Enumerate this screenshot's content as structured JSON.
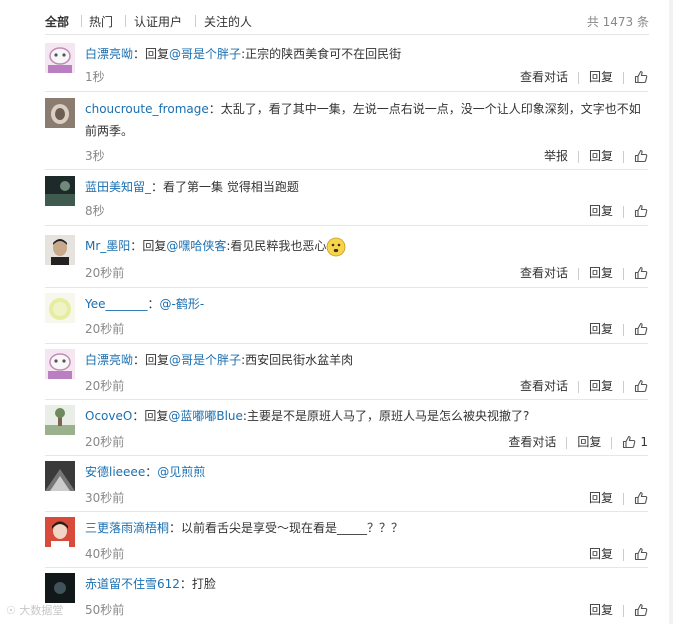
{
  "tabs": {
    "all": "全部",
    "hot": "热门",
    "verified": "认证用户",
    "following": "关注的人",
    "total": "共 1473 条"
  },
  "actions": {
    "view_thread": "查看对话",
    "reply": "回复",
    "report": "举报"
  },
  "comments": [
    {
      "user": "白漂亮呦",
      "sep": "：",
      "pre": "回复",
      "mention": "@哥是个胖子",
      "body": ":正宗的陕西美食可不在回民街",
      "time": "1秒"
    },
    {
      "user": "choucroute_fromage",
      "sep": "：",
      "body": "太乱了，看了其中一集，左说一点右说一点，没一个让人印象深刻，文字也不如前两季。",
      "time": "3秒"
    },
    {
      "user": "蓝田美知留_",
      "sep": "：",
      "body": "看了第一集 觉得相当跑题",
      "time": "8秒"
    },
    {
      "user": "Mr_墨阳",
      "sep": "：",
      "pre": "回复",
      "mention": "@嘿哈侠客",
      "body": ":看见民粹我也恶心",
      "time": "20秒前"
    },
    {
      "user": "Yee_______",
      "sep": "：",
      "mention": "@-鹤形-",
      "time": "20秒前"
    },
    {
      "user": "白漂亮呦",
      "sep": "：",
      "pre": "回复",
      "mention": "@哥是个胖子",
      "body": ":西安回民街水盆羊肉",
      "time": "20秒前"
    },
    {
      "user": "OcoveO",
      "sep": "：",
      "pre": "回复",
      "mention": "@蓝嘟嘟Blue",
      "body": ":主要是不是原班人马了，原班人马是怎么被央视撤了?",
      "time": "20秒前",
      "likes": "1"
    },
    {
      "user": "安德lieeee",
      "sep": "：",
      "mention": "@见煎煎",
      "time": "30秒前"
    },
    {
      "user": "三更落雨滴梧桐",
      "sep": "：",
      "body": "以前看舌尖是享受～现在看是_____？？？",
      "time": "40秒前"
    },
    {
      "user": "赤道留不住雪612",
      "sep": "：",
      "body": "打脸",
      "time": "50秒前"
    }
  ],
  "colors": {
    "link": "#1a6fb0",
    "text": "#333333",
    "muted": "#888888",
    "divider": "#e6e6e6"
  },
  "watermark": "大数据堂",
  "icons": {
    "like": "thumbs-up-icon",
    "emoji": "smiley-emoji-icon"
  }
}
